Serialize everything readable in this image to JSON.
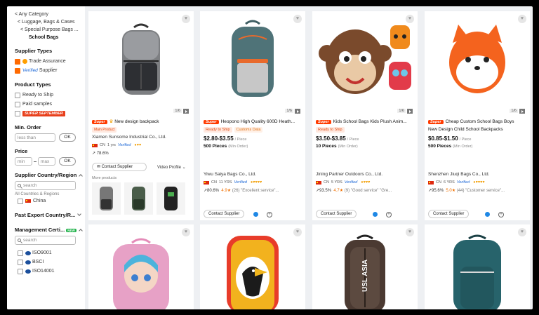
{
  "sidebar": {
    "breadcrumbs": [
      "< Any Category",
      "< Luggage, Bags & Cases",
      "< Special Purpose Bags ...",
      "School Bags"
    ],
    "supplier_types": {
      "title": "Supplier Types",
      "options": [
        {
          "label": "Trade Assurance",
          "checked": true
        },
        {
          "label": "Supplier",
          "badge": "Verified",
          "checked": true
        }
      ]
    },
    "product_types": {
      "title": "Product Types",
      "options": [
        {
          "label": "Ready to Ship"
        },
        {
          "label": "Paid samples"
        },
        {
          "label": "SUPER SEPTEMBER"
        }
      ]
    },
    "min_order": {
      "title": "Min. Order",
      "placeholder": "less than",
      "ok": "OK"
    },
    "price": {
      "title": "Price",
      "min": "min",
      "max": "max",
      "ok": "OK"
    },
    "country": {
      "title": "Supplier Country/Region",
      "search": "search",
      "all": "All Countries & Regions",
      "option": "China"
    },
    "export": {
      "title": "Past Export Country/R..."
    },
    "certs": {
      "title": "Management Certi...",
      "new": "NEW",
      "search": "search",
      "options": [
        "ISO9001",
        "BSCI",
        "ISO14001"
      ]
    }
  },
  "cards": [
    {
      "title": "New design backpack",
      "badge": "Super",
      "tag": "Main Product",
      "supplier": "Xiamen Sunsome Industrial Co., Ltd.",
      "country": "CN",
      "years": "1 yrs",
      "verified": "Verified",
      "rate": "78.6%",
      "contact": "Contact Supplier",
      "video": "Video Profile",
      "more": "More products",
      "count": "1/6"
    },
    {
      "badge": "Super",
      "title": "Heopono High Quality 600D Heath...",
      "rts": "Ready to Ship",
      "custom": "Customs Data",
      "price": "$2.80-$3.55",
      "unit": "/ Piece",
      "moq": "500 Pieces",
      "moq_note": "(Min Order)",
      "supplier": "Yiwu Saiya Bags Co., Ltd.",
      "country": "CN",
      "years": "11 YRS",
      "verified": "Verified",
      "rate": "80.6%",
      "rating": "4.9",
      "reviews": "(26)",
      "review_text": "\"Excellent service\"...",
      "contact": "Contact Supplier",
      "count": "1/6"
    },
    {
      "badge": "Super",
      "title": "Kids School Bags Kids Plush Anim...",
      "rts": "Ready to Ship",
      "price": "$3.50-$3.85",
      "unit": "/ Piece",
      "moq": "10 Pieces",
      "moq_note": "(Min Order)",
      "supplier": "Jining Partner Outdoors Co., Ltd.",
      "country": "CN",
      "years": "5 YRS",
      "verified": "Verified",
      "rate": "93.5%",
      "rating": "4.7",
      "reviews": "(9)",
      "review_text": "\"Good service\" \"Gre...",
      "contact": "Contact Supplier",
      "count": "1/6"
    },
    {
      "badge": "Super",
      "title": "Cheap Custom School Bags Boys",
      "title2": "New Design Child School Backpacks",
      "price": "$0.85-$1.50",
      "unit": "/ Piece",
      "moq": "500 Pieces",
      "moq_note": "(Min Order)",
      "supplier": "Shenzhen Jiuqi Bags Co., Ltd.",
      "country": "CN",
      "years": "6 YRS",
      "verified": "Verified",
      "rate": "95.6%",
      "rating": "5.0",
      "reviews": "(44)",
      "review_text": "\"Customer service\"...",
      "contact": "Contact Supplier",
      "count": "1/6"
    }
  ],
  "bottom_texts": {
    "b3": "USL ASIA"
  },
  "icons": {
    "heart": "heart-icon",
    "play": "play-icon",
    "plus": "plus-icon"
  }
}
